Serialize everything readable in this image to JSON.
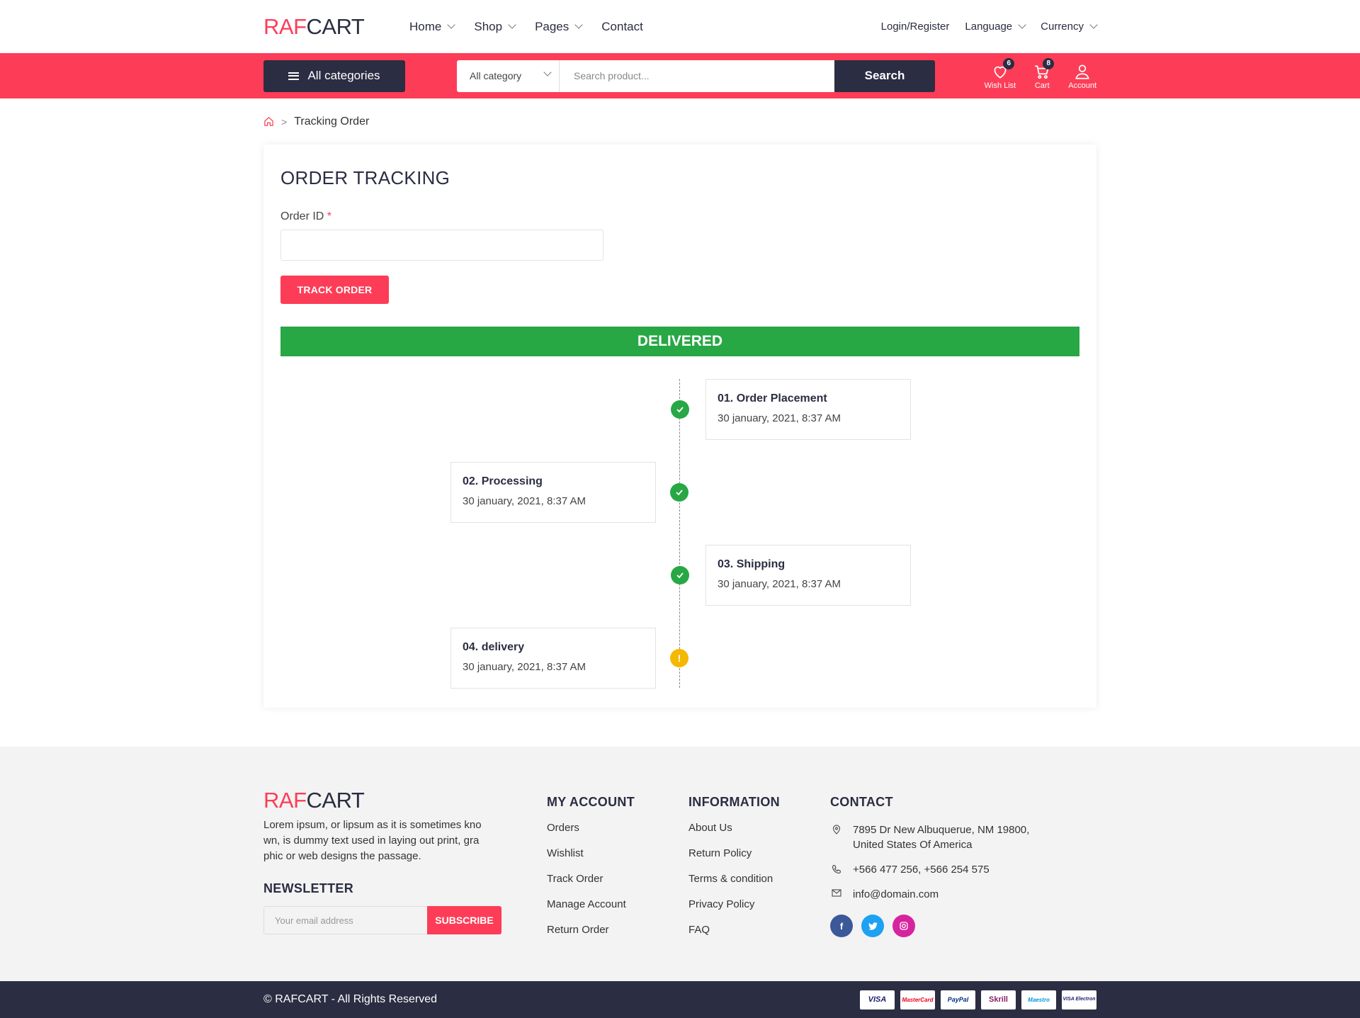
{
  "brand": {
    "part1": "RAF",
    "part2": "CART"
  },
  "nav": {
    "home": "Home",
    "shop": "Shop",
    "pages": "Pages",
    "contact": "Contact"
  },
  "topright": {
    "login": "Login/Register",
    "language": "Language",
    "currency": "Currency"
  },
  "searchbar": {
    "all_categories": "All categories",
    "category_select": "All category",
    "placeholder": "Search product...",
    "button": "Search"
  },
  "header_icons": {
    "wishlist": {
      "label": "Wish List",
      "count": "6"
    },
    "cart": {
      "label": "Cart",
      "count": "8"
    },
    "account": {
      "label": "Account"
    }
  },
  "breadcrumb": {
    "current": "Tracking Order"
  },
  "tracking": {
    "title": "ORDER TRACKING",
    "order_id_label": "Order ID",
    "required_mark": "*",
    "order_id_value": "",
    "button": "TRACK ORDER",
    "status": "DELIVERED",
    "steps": [
      {
        "title": "01. Order Placement",
        "date": "30 january, 2021, 8:37 AM",
        "state": "done"
      },
      {
        "title": "02. Processing",
        "date": "30 january, 2021, 8:37 AM",
        "state": "done"
      },
      {
        "title": "03. Shipping",
        "date": "30 january, 2021, 8:37 AM",
        "state": "done"
      },
      {
        "title": "04. delivery",
        "date": "30 january, 2021, 8:37 AM",
        "state": "pending"
      }
    ]
  },
  "footer": {
    "description": "Lorem ipsum, or lipsum as it is sometimes kno wn, is dummy text used in laying out print, gra phic or web designs the passage.",
    "newsletter_title": "NEWSLETTER",
    "newsletter_placeholder": "Your email address",
    "subscribe": "SUBSCRIBE",
    "my_account": {
      "title": "MY ACCOUNT",
      "links": [
        "Orders",
        "Wishlist",
        "Track Order",
        "Manage Account",
        "Return Order"
      ]
    },
    "information": {
      "title": "INFORMATION",
      "links": [
        "About Us",
        "Return Policy",
        "Terms & condition",
        "Privacy Policy",
        "FAQ"
      ]
    },
    "contact": {
      "title": "CONTACT",
      "address_line1": "7895 Dr New Albuquerue, NM 19800,",
      "address_line2": "United States Of America",
      "phone": "+566 477 256, +566 254 575",
      "email": "info@domain.com"
    },
    "socials": [
      "facebook-icon",
      "twitter-icon",
      "instagram-icon"
    ],
    "copyright": "© RAFCART - All Rights Reserved",
    "payments": [
      "VISA",
      "MasterCard",
      "PayPal",
      "Skrill",
      "Maestro",
      "VISA Electron"
    ]
  },
  "colors": {
    "accent": "#fd3d57",
    "dark": "#2b2d42",
    "success": "#28a745",
    "warning": "#f5b800"
  }
}
